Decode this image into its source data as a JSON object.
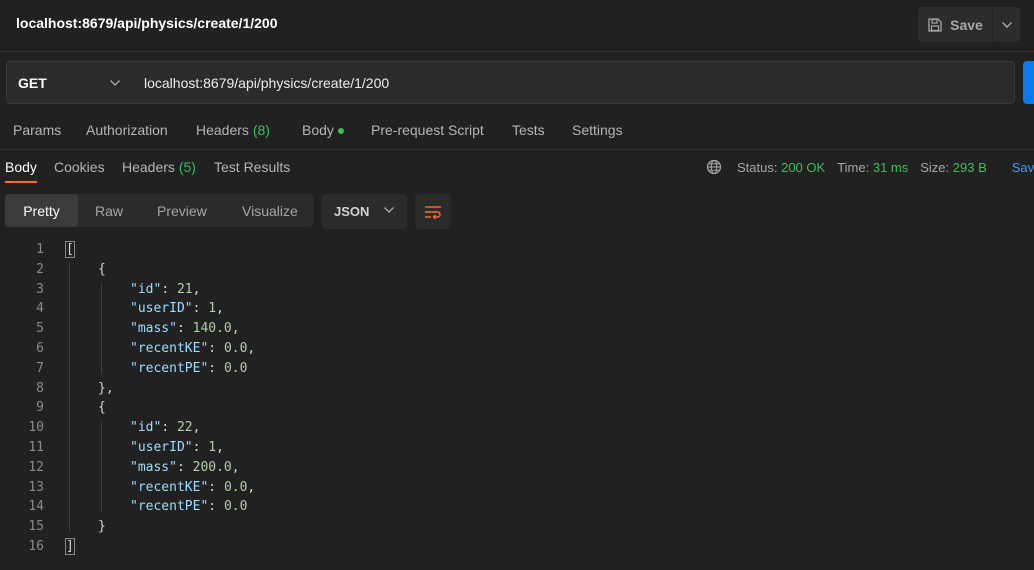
{
  "header": {
    "title": "localhost:8679/api/physics/create/1/200",
    "save_label": "Save"
  },
  "request": {
    "method": "GET",
    "url": "localhost:8679/api/physics/create/1/200"
  },
  "request_tabs": {
    "params": "Params",
    "authorization": "Authorization",
    "headers": "Headers",
    "headers_count": "(8)",
    "body": "Body",
    "prerequest": "Pre-request Script",
    "tests": "Tests",
    "settings": "Settings"
  },
  "response_tabs": {
    "body": "Body",
    "cookies": "Cookies",
    "headers": "Headers",
    "headers_count": "(5)",
    "test_results": "Test Results"
  },
  "status": {
    "status_label": "Status:",
    "status_value": "200 OK",
    "time_label": "Time:",
    "time_value": "31 ms",
    "size_label": "Size:",
    "size_value": "293 B",
    "save_response": "Sav"
  },
  "view": {
    "pretty": "Pretty",
    "raw": "Raw",
    "preview": "Preview",
    "visualize": "Visualize",
    "format": "JSON"
  },
  "response_body": [
    {
      "id": 21,
      "userID": 1,
      "mass": "140.0",
      "recentKE": "0.0",
      "recentPE": "0.0"
    },
    {
      "id": 22,
      "userID": 1,
      "mass": "200.0",
      "recentKE": "0.0",
      "recentPE": "0.0"
    }
  ],
  "line_numbers": [
    "1",
    "2",
    "3",
    "4",
    "5",
    "6",
    "7",
    "8",
    "9",
    "10",
    "11",
    "12",
    "13",
    "14",
    "15",
    "16"
  ],
  "colors": {
    "accent": "#ff6c37",
    "success": "#3ebd5c",
    "link": "#3c9dfc",
    "send": "#097bed"
  }
}
